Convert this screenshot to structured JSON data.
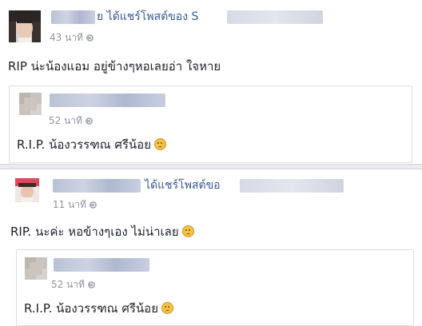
{
  "post1": {
    "shared_text": "ย ได้แชร์โพสต์ของ S",
    "time": "43 นาที",
    "body": "RIP น่ะน้องแอม อยู่ข้างๆหอเลยอ่า ใจหาย",
    "card": {
      "time": "52 นาที",
      "text": "R.I.P. น้องวรรฑณ ศรีน้อย"
    }
  },
  "post2": {
    "shared_text": "ได้แชร์โพสต์ขอ",
    "time": "11 นาที",
    "body": "RIP. นะค่ะ หอข้างๆเอง ไม่น่าเลย",
    "card": {
      "time": "52 นาที",
      "text": "R.I.P. น้องวรรฑณ ศรีน้อย"
    }
  },
  "icons": {
    "privacy": "globe-icon",
    "menu": "chevron-down-icon",
    "emoji": "crying-face-icon"
  },
  "colors": {
    "link": "#365899",
    "meta": "#90949c",
    "text": "#1d2129",
    "separator": "#e9ebee"
  }
}
